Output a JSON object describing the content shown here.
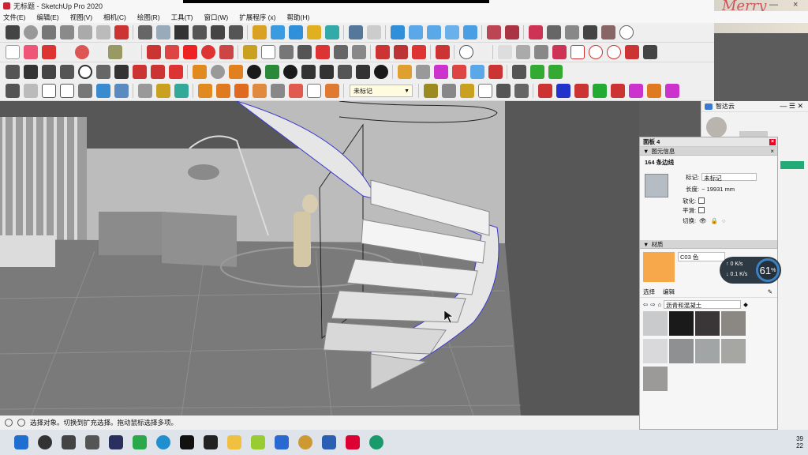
{
  "window": {
    "doc_name": "无标题",
    "app_name": "SketchUp Pro 2020",
    "title": "无标题 - SketchUp Pro 2020",
    "minimize": "—",
    "close": "×"
  },
  "overlay": {
    "banner_text": "Merry Christmas"
  },
  "menu": [
    "文件(E)",
    "编辑(E)",
    "视图(V)",
    "相机(C)",
    "绘图(R)",
    "工具(T)",
    "窗口(W)",
    "扩展程序 (x)",
    "帮助(H)"
  ],
  "toolbar": {
    "tag_select": "未标记"
  },
  "status": {
    "text": "选择对象。切换到扩充选择。拖动鼠标选择多项。"
  },
  "taskbar": {
    "time": "39",
    "date": "22"
  },
  "right_deck": {
    "title": "智达云"
  },
  "panel": {
    "title": "面板 4",
    "entity_info": {
      "section": "图元信息",
      "selection": "164 条边线",
      "tag_label": "标记:",
      "tag_value": "未标记",
      "length_label": "长度:",
      "length_value": "~ 19931 mm",
      "soften_label": "软化:",
      "smooth_label": "平滑:",
      "toggle_label": "切换:"
    },
    "materials": {
      "section": "材质",
      "current_name": "C03 色",
      "current_color": "#f7a84a",
      "tab_select": "选择",
      "tab_edit": "编辑",
      "library": "沥青和混凝土",
      "swatch_colors": [
        "#c9cacc",
        "#1a1a1a",
        "#3a3536",
        "#8b8884",
        "#d9d9db",
        "#8e9091",
        "#a2a5a6",
        "#a6a7a3",
        "#9b9a98"
      ]
    }
  },
  "net_speed": {
    "up": "0",
    "down": "0.1",
    "unit": "K/s",
    "percent": "61",
    "percent_unit": "%"
  }
}
